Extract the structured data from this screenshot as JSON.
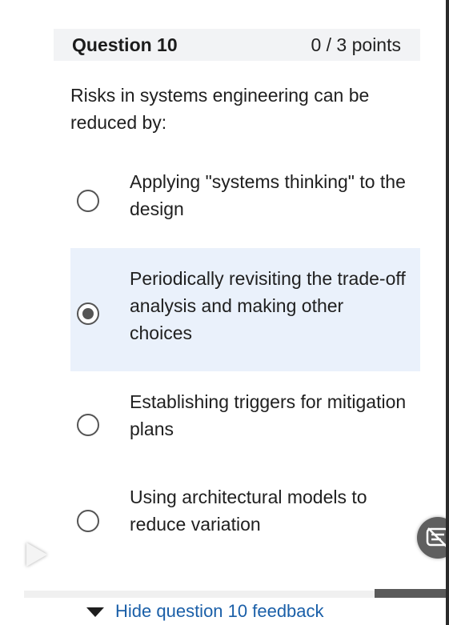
{
  "question": {
    "title": "Question 10",
    "points": "0 / 3 points",
    "prompt": "Risks in systems engineering can be reduced by:"
  },
  "options": [
    {
      "text": "Applying \"systems thinking\" to the design",
      "selected": false
    },
    {
      "text": "Periodically revisiting the trade-off analysis and making other choices",
      "selected": true
    },
    {
      "text": "Establishing triggers for mitigation plans",
      "selected": false
    },
    {
      "text": "Using architectural models to reduce variation",
      "selected": false
    }
  ],
  "feedback_toggle": {
    "label": "Hide question 10 feedback"
  },
  "media_controls": {
    "play_icon": "play-icon",
    "captions_icon": "captions-icon"
  },
  "colors": {
    "header_bg": "#f2f3f5",
    "selected_bg": "#eaf1fb",
    "link": "#1a5fa8"
  }
}
